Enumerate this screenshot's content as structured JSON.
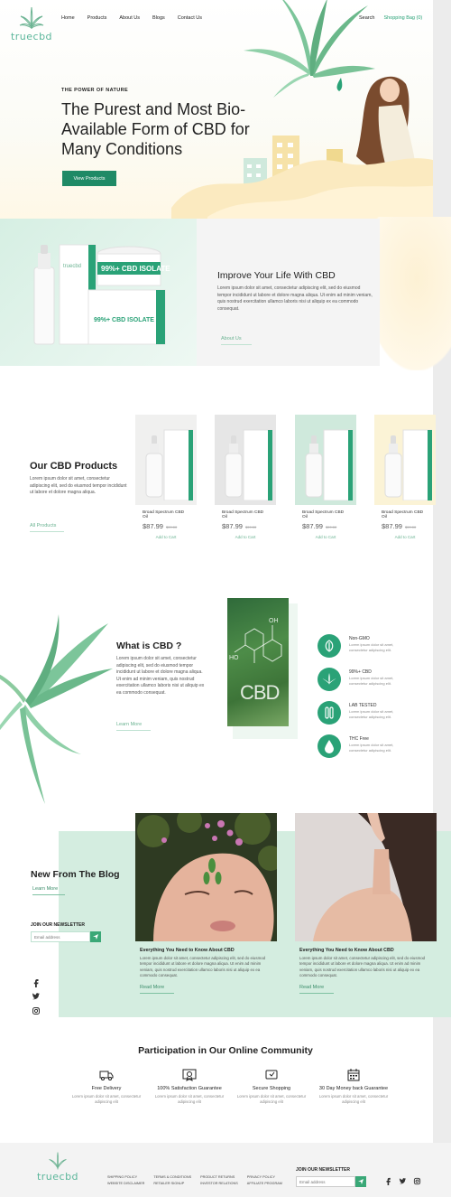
{
  "brand": {
    "logo_text": "truecbd",
    "accent": "#2aa277",
    "dark_green": "#1f8a66"
  },
  "nav": {
    "items": [
      "Home",
      "Products",
      "About Us",
      "Blogs",
      "Contact Us"
    ],
    "search": "Search",
    "bag": "Shopping Bag (0)"
  },
  "hero": {
    "eyebrow": "THE POWER OF NATURE",
    "title": "The Purest and Most Bio-Available Form of CBD for Many Conditions",
    "button": "View Products"
  },
  "improve": {
    "title": "Improve Your Life With CBD",
    "text": "Lorem ipsum dolor sit amet, consectetur adipiscing elit, sed do eiusmod tempor incididunt ut labore et dolore magna aliqua. Ut enim ad minim veniam, quis nostrud exercitation ullamco laboris nisi ut aliquip ex ea commodo consequat.",
    "link": "About Us",
    "jar_label": "99%+ CBD ISOLATE",
    "box_label": "99%+ CBD ISOLATE"
  },
  "products": {
    "title": "Our CBD Products",
    "text": "Lorem ipsum dolor sit amet, consectetur adipiscing elit, sed do eiusmod tempor incididunt ut labore et dolore magna aliqua.",
    "link": "All Products",
    "cards": [
      {
        "name": "Broad Spectrum CBD Oil",
        "price": "$87.99",
        "old": "$99.00",
        "cta": "Add to Cart",
        "bg": "#f0f0ef"
      },
      {
        "name": "Broad Spectrum CBD Oil",
        "price": "$87.99",
        "old": "$99.00",
        "cta": "Add to Cart",
        "bg": "#e6e6e6"
      },
      {
        "name": "Broad Spectrum CBD Oil",
        "price": "$87.99",
        "old": "$99.00",
        "cta": "Add to Cart",
        "bg": "#cfe9dc"
      },
      {
        "name": "Broad Spectrum CBD Oil",
        "price": "$87.99",
        "old": "$99.00",
        "cta": "Add to Cart",
        "bg": "#fbf3d6"
      }
    ]
  },
  "what": {
    "title": "What is CBD ?",
    "text": "Lorem ipsum dolor sit amet, consectetur adipiscing elit, sed do eiusmod tempor incididunt ut labore et dolore magna aliqua. Ut enim ad minim veniam, quis nostrud exercitation ullamco laboris nisi ut aliquip ex ea commodo consequat.",
    "link": "Learn More",
    "image_text": "CBD",
    "features": [
      {
        "title": "Non-GMO",
        "text": "Lorem ipsum dolor sit amet, consectetur adipiscing elit.",
        "icon": "leaf-icon"
      },
      {
        "title": "99%+ CBD",
        "text": "Lorem ipsum dolor sit amet, consectetur adipiscing elit.",
        "icon": "cannabis-icon"
      },
      {
        "title": "LAB TESTED",
        "text": "Lorem ipsum dolor sit amet, consectetur adipiscing elit.",
        "icon": "test-tube-icon"
      },
      {
        "title": "THC Free",
        "text": "Lorem ipsum dolor sit amet, consectetur adipiscing elit.",
        "icon": "drop-icon"
      }
    ]
  },
  "blog": {
    "title": "New From The Blog",
    "link": "Learn More",
    "newsletter_label": "JOIN OUR NEWSLETTER",
    "newsletter_placeholder": "Email address",
    "posts": [
      {
        "title": "Everything You Need to Know About CBD",
        "text": "Lorem ipsum dolor sit amet, consectetur adipiscing elit, sed do eiusmod tempor incididunt ut labore et dolore magna aliqua. Ut enim ad minim veniam, quis nostrud exercitation ullamco laboris nisi ut aliquip ex ea commodo consequat.",
        "link": "Read More"
      },
      {
        "title": "Everything You Need to Know About CBD",
        "text": "Lorem ipsum dolor sit amet, consectetur adipiscing elit, sed do eiusmod tempor incididunt ut labore et dolore magna aliqua. Ut enim ad minim veniam, quis nostrud exercitation ullamco laboris nisi ut aliquip ex ea commodo consequat.",
        "link": "Read More"
      }
    ]
  },
  "community": {
    "title": "Participation in Our Online Community",
    "items": [
      {
        "title": "Free Delivery",
        "text": "Lorem ipsum dolor sit amet, consectetur adipiscing elit",
        "icon": "truck-icon"
      },
      {
        "title": "100% Satisfaction Guarantee",
        "text": "Lorem ipsum dolor sit amet, consectetur adipiscing elit",
        "icon": "certificate-icon"
      },
      {
        "title": "Secure Shopping",
        "text": "Lorem ipsum dolor sit amet, consectetur adipiscing elit",
        "icon": "secure-shopping-icon"
      },
      {
        "title": "30 Day Money back Guarantee",
        "text": "Lorem ipsum dolor sit amet, consectetur adipiscing elit",
        "icon": "calendar-icon"
      }
    ]
  },
  "footer": {
    "links": [
      "SHIPPING POLICY",
      "TERMS & CONDITIONS",
      "PRODUCT RETURNS",
      "PRIVACY POLICY",
      "WEBSITE DISCLAIMER",
      "RETAILER SIGNUP",
      "INVESTOR RELATIONS",
      "AFFILIATE PROGRAM"
    ],
    "newsletter_label": "JOIN OUR NEWSLETTER",
    "newsletter_placeholder": "Email address"
  }
}
